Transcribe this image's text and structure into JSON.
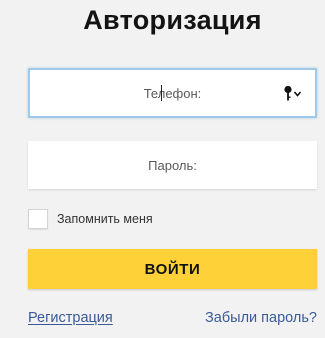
{
  "header": {
    "title": "Авторизация"
  },
  "form": {
    "phone_placeholder": "Телефон:",
    "password_placeholder": "Пароль:",
    "remember_label": "Запомнить меня",
    "remember_checked": false,
    "submit_label": "ВОЙТИ"
  },
  "links": {
    "register": "Регистрация",
    "forgot": "Забыли пароль?"
  },
  "icons": {
    "password_manager": "key-dropdown-icon"
  },
  "colors": {
    "background": "#f2f2f2",
    "accent_button": "#ffd138",
    "focus_border": "#9ec9ea",
    "link": "#3a5a9b"
  }
}
